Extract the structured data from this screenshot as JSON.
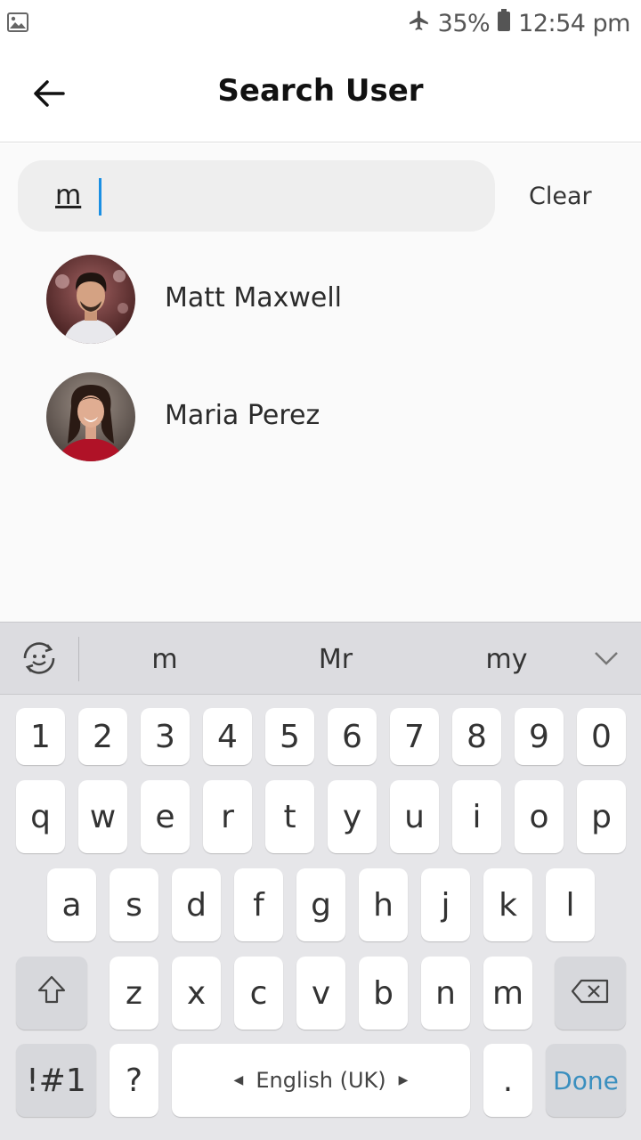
{
  "status_bar": {
    "battery_percent": "35%",
    "time": "12:54 pm",
    "left_icon": "image-icon",
    "icons": [
      "airplane-icon",
      "battery-icon"
    ]
  },
  "header": {
    "title": "Search User",
    "back_icon": "arrow-left-icon"
  },
  "search": {
    "value": "m",
    "clear_label": "Clear"
  },
  "results": [
    {
      "name": "Matt Maxwell"
    },
    {
      "name": "Maria Perez"
    }
  ],
  "keyboard": {
    "suggestions": [
      "m",
      "Mr",
      "my"
    ],
    "number_row": [
      "1",
      "2",
      "3",
      "4",
      "5",
      "6",
      "7",
      "8",
      "9",
      "0"
    ],
    "row1": [
      "q",
      "w",
      "e",
      "r",
      "t",
      "y",
      "u",
      "i",
      "o",
      "p"
    ],
    "row2": [
      "a",
      "s",
      "d",
      "f",
      "g",
      "h",
      "j",
      "k",
      "l"
    ],
    "row3": [
      "z",
      "x",
      "c",
      "v",
      "b",
      "n",
      "m"
    ],
    "symbols_label": "!#1",
    "question_label": "?",
    "space_label": "English (UK)",
    "period_label": ".",
    "done_label": "Done"
  },
  "colors": {
    "caret": "#1a8fe3",
    "done": "#3a8fbf",
    "keyboard_bg": "#e6e6e9"
  }
}
